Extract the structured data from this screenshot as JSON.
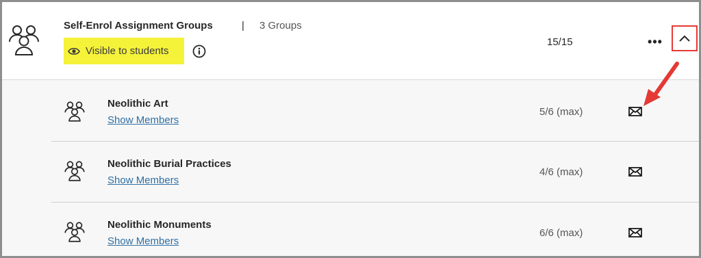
{
  "header": {
    "title": "Self-Enrol Assignment Groups",
    "separator": "|",
    "groups_count": "3 Groups",
    "visibility_label": "Visible to students",
    "enrolment": "15/15",
    "more_label": "•••"
  },
  "groups": [
    {
      "name": "Neolithic Art",
      "link": "Show Members",
      "capacity": "5/6 (max)"
    },
    {
      "name": "Neolithic Burial Practices",
      "link": "Show Members",
      "capacity": "4/6 (max)"
    },
    {
      "name": "Neolithic Monuments",
      "link": "Show Members",
      "capacity": "6/6 (max)"
    }
  ],
  "colors": {
    "highlight": "#f5f23a",
    "annotation_red": "#e53935",
    "link": "#2f6fa3"
  },
  "icons": [
    "group-icon",
    "eye-icon",
    "info-icon",
    "more-icon",
    "chevron-up-icon",
    "mail-icon"
  ]
}
